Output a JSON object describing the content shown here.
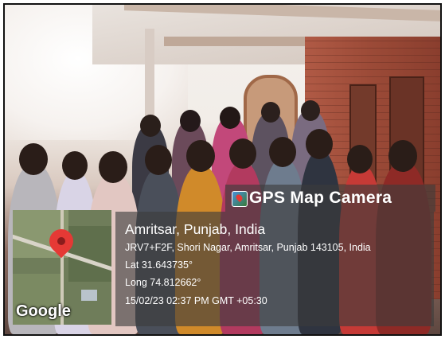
{
  "overlay": {
    "app_name": "GPS Map Camera",
    "location_title": "Amritsar, Punjab, India",
    "address": "JRV7+F2F, Shori Nagar, Amritsar, Punjab 143105, India",
    "latitude": "Lat 31.643735°",
    "longitude": "Long 74.812662°",
    "datetime": "15/02/23 02:37 PM GMT +05:30"
  },
  "map": {
    "logo_text": "Google",
    "marker_icon": "map-pin-icon"
  }
}
